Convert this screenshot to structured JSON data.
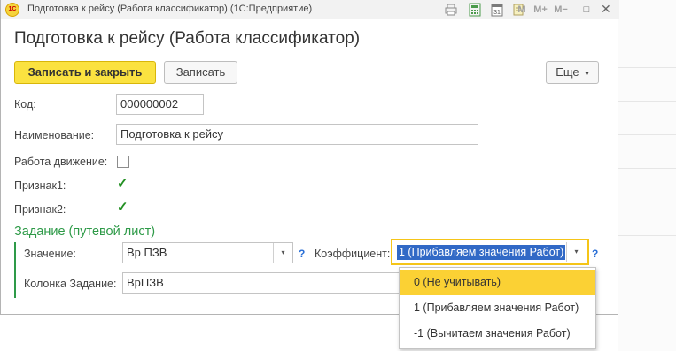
{
  "window": {
    "title": "Подготовка к рейсу (Работа классификатор)  (1С:Предприятие)",
    "app_icon": "1С",
    "toolbar_icons": [
      "print-icon",
      "calculator-icon",
      "calendar-icon",
      "notes-icon"
    ],
    "toolbar_text": {
      "m": "M",
      "m_plus": "M+",
      "m_minus": "M−",
      "restore": "□",
      "close": "✕"
    }
  },
  "form": {
    "title": "Подготовка к рейсу (Работа классификатор)",
    "buttons": {
      "save_close": "Записать и закрыть",
      "save": "Записать",
      "more": "Еще",
      "more_arrow": "▾"
    },
    "fields": {
      "code_label": "Код:",
      "code_value": "000000002",
      "name_label": "Наименование:",
      "name_value": "Подготовка к рейсу",
      "work_move_label": "Работа движение:",
      "work_move_checked": false,
      "sign1_label": "Признак1:",
      "sign1_checked": true,
      "sign2_label": "Признак2:",
      "sign2_checked": true
    },
    "group": {
      "title": "Задание (путевой лист)",
      "value_label": "Значение:",
      "value_value": "Вр ПЗВ",
      "coef_label": "Коэффициент:",
      "coef_value": "1 (Прибавляем значения Работ)",
      "column_label": "Колонка Задание:",
      "column_value": "ВрПЗВ",
      "help": "?",
      "select_arrow": "▾"
    },
    "dropdown": {
      "options": [
        "0 (Не учитывать)",
        "1 (Прибавляем значения Работ)",
        "-1 (Вычитаем значения Работ)"
      ],
      "highlighted_index": 0
    }
  },
  "colors": {
    "primary_button": "#fbe240",
    "group_accent": "#2e9a48",
    "selection": "#3169c6",
    "dropdown_highlight": "#fbd134",
    "focus_frame": "#f5c518"
  }
}
